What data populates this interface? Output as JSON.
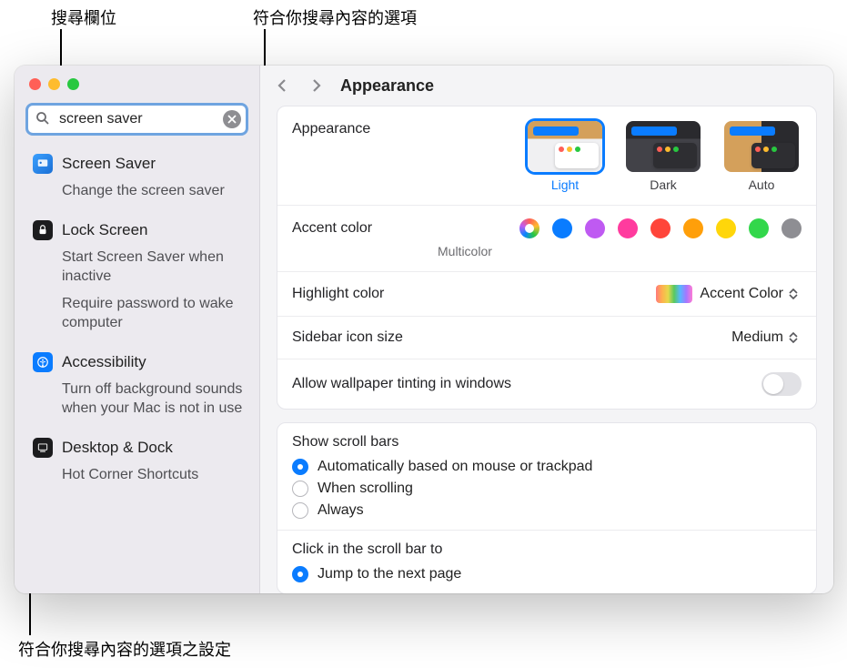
{
  "callouts": {
    "search": "搜尋欄位",
    "results": "符合你搜尋內容的選項",
    "settings": "符合你搜尋內容的選項之設定"
  },
  "search": {
    "value": "screen saver"
  },
  "sidebar": {
    "groups": [
      {
        "title": "Screen Saver",
        "items": [
          "Change the screen saver"
        ]
      },
      {
        "title": "Lock Screen",
        "items": [
          "Start Screen Saver when inactive",
          "Require password to wake computer"
        ]
      },
      {
        "title": "Accessibility",
        "items": [
          "Turn off background sounds when your Mac is not in use"
        ]
      },
      {
        "title": "Desktop & Dock",
        "items": [
          "Hot Corner Shortcuts"
        ]
      }
    ]
  },
  "page": {
    "title": "Appearance"
  },
  "appearance": {
    "label": "Appearance",
    "options": [
      {
        "label": "Light",
        "selected": true
      },
      {
        "label": "Dark",
        "selected": false
      },
      {
        "label": "Auto",
        "selected": false
      }
    ]
  },
  "accent": {
    "label": "Accent color",
    "selected_label": "Multicolor",
    "colors": [
      "multi",
      "#0a7cff",
      "#bf5af2",
      "#ff3b9e",
      "#ff453a",
      "#ff9f0a",
      "#ffd60a",
      "#32d74b",
      "#8e8e93"
    ]
  },
  "highlight": {
    "label": "Highlight color",
    "value": "Accent Color"
  },
  "sidebar_icon": {
    "label": "Sidebar icon size",
    "value": "Medium"
  },
  "wallpaper_tint": {
    "label": "Allow wallpaper tinting in windows",
    "value": false
  },
  "scroll_bars": {
    "label": "Show scroll bars",
    "options": [
      {
        "label": "Automatically based on mouse or trackpad",
        "checked": true
      },
      {
        "label": "When scrolling",
        "checked": false
      },
      {
        "label": "Always",
        "checked": false
      }
    ]
  },
  "scroll_click": {
    "label": "Click in the scroll bar to",
    "options": [
      {
        "label": "Jump to the next page",
        "checked": true
      }
    ]
  }
}
